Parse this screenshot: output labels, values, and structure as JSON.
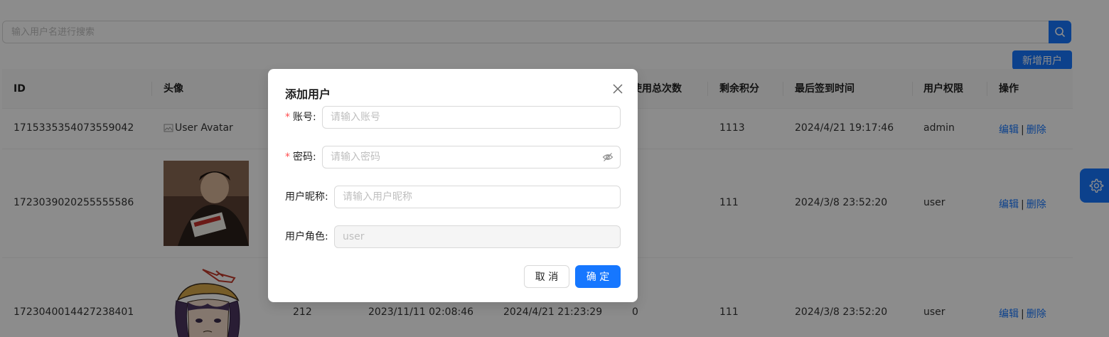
{
  "search": {
    "placeholder": "输入用户名进行搜索"
  },
  "toolbar": {
    "add_user_label": "新增用户"
  },
  "table": {
    "headers": [
      "ID",
      "头像",
      "",
      "",
      "",
      "使用总次数",
      "剩余积分",
      "最后签到时间",
      "用户权限",
      "操作"
    ],
    "rows": [
      {
        "id": "1715335354073559042",
        "avatar_alt": "User Avatar",
        "col3": "",
        "col4": "",
        "col5": "",
        "total_uses": "",
        "points": "1113",
        "last_sign_in": "2024/4/21 19:17:46",
        "role": "admin",
        "edit": "编辑",
        "sep": "|",
        "delete": "删除"
      },
      {
        "id": "1723039020255555586",
        "avatar_alt": "",
        "col3": "",
        "col4": "",
        "col5": "",
        "total_uses": "",
        "points": "111",
        "last_sign_in": "2024/3/8 23:52:20",
        "role": "user",
        "edit": "编辑",
        "sep": "|",
        "delete": "删除"
      },
      {
        "id": "1723040014427238401",
        "avatar_alt": "",
        "col3": "212",
        "col4": "2023/11/11 02:08:46",
        "col5": "2024/4/21 21:23:29",
        "total_uses": "0",
        "points": "111",
        "last_sign_in": "2024/3/8 23:52:20",
        "role": "user",
        "edit": "编辑",
        "sep": "|",
        "delete": "删除"
      }
    ]
  },
  "modal": {
    "title": "添加用户",
    "required_mark": "*",
    "account_label": "账号:",
    "account_placeholder": "请输入账号",
    "password_label": "密码:",
    "password_placeholder": "请输入密码",
    "nickname_label": "用户昵称:",
    "nickname_placeholder": "请输入用户昵称",
    "role_label": "用户角色:",
    "role_value": "user",
    "cancel_label": "取 消",
    "ok_label": "确 定"
  },
  "colors": {
    "primary": "#1677ff",
    "overlay": "rgba(0,0,0,0.45)",
    "required": "#ff4d4f"
  },
  "icons": {
    "search": "search-icon",
    "settings": "gear-icon",
    "close": "close-icon",
    "password_toggle": "eye-invisible-icon"
  }
}
